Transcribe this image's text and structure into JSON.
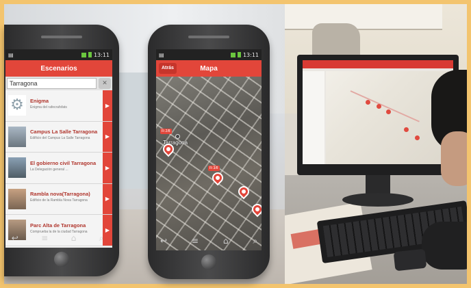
{
  "left_phone": {
    "status_time": "13:11",
    "title": "Escenarios",
    "search": {
      "value": "Tarragona"
    },
    "clear_icon": "clear-icon",
    "items": [
      {
        "title": "Enigma",
        "subtitle": "Enigma del rafecrafsfats",
        "thumb": "gear-icon"
      },
      {
        "title": "Campus La Salle Tarragona",
        "subtitle": "Edificio del Campus La Salle Tarragona",
        "thumb": "photo"
      },
      {
        "title": "El gobierno civil Tarragona",
        "subtitle": "La Delegación general ...",
        "thumb": "photo"
      },
      {
        "title": "Rambla nova(Tarragona)",
        "subtitle": "Edificio de la Rambla Nova Tarragona",
        "thumb": "photo"
      },
      {
        "title": "Parc Alta de Tarragona",
        "subtitle": "Comprueba la de la ciudad Tarragona",
        "thumb": "photo"
      }
    ],
    "arrow_glyph": "▶"
  },
  "right_phone": {
    "status_time": "13:11",
    "title": "Mapa",
    "back_label": "Atrás",
    "map_label": "Tarragona",
    "pins": [
      {
        "tag": "Fi 2/8"
      },
      {
        "tag": "Fi 3/8"
      },
      {
        "tag": ""
      },
      {
        "tag": ""
      }
    ]
  },
  "nav_glyphs": {
    "back": "↩",
    "menu": "≡",
    "home": "⌂",
    "search": "⌕"
  },
  "colors": {
    "accent": "#e2463a",
    "frame": "#f3c46e"
  }
}
